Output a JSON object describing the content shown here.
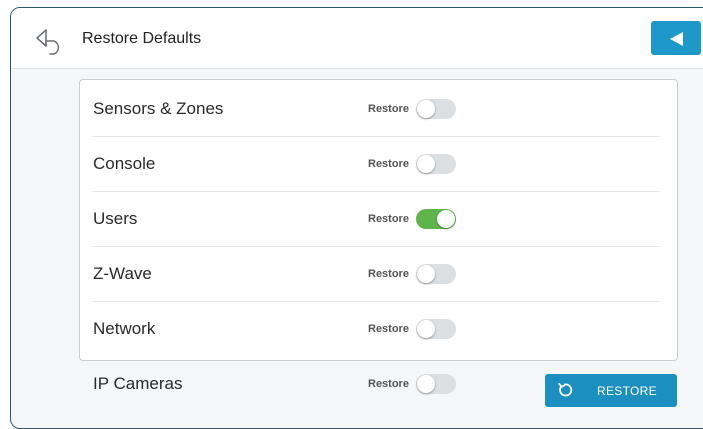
{
  "header": {
    "back_icon": "undo-arrow-icon",
    "title": "Restore Defaults",
    "nav_icon": "triangle-left-icon"
  },
  "colors": {
    "accent": "#1e97c9",
    "toggle_on": "#5fb54c",
    "toggle_off": "#dcdfe2"
  },
  "items": [
    {
      "label": "Sensors & Zones",
      "restore_label": "Restore",
      "enabled": false
    },
    {
      "label": "Console",
      "restore_label": "Restore",
      "enabled": false
    },
    {
      "label": "Users",
      "restore_label": "Restore",
      "enabled": true
    },
    {
      "label": "Z-Wave",
      "restore_label": "Restore",
      "enabled": false
    },
    {
      "label": "Network",
      "restore_label": "Restore",
      "enabled": false
    },
    {
      "label": "IP Cameras",
      "restore_label": "Restore",
      "enabled": false
    }
  ],
  "footer": {
    "restore_button_label": "RESTORE",
    "restore_icon": "restore-icon"
  }
}
